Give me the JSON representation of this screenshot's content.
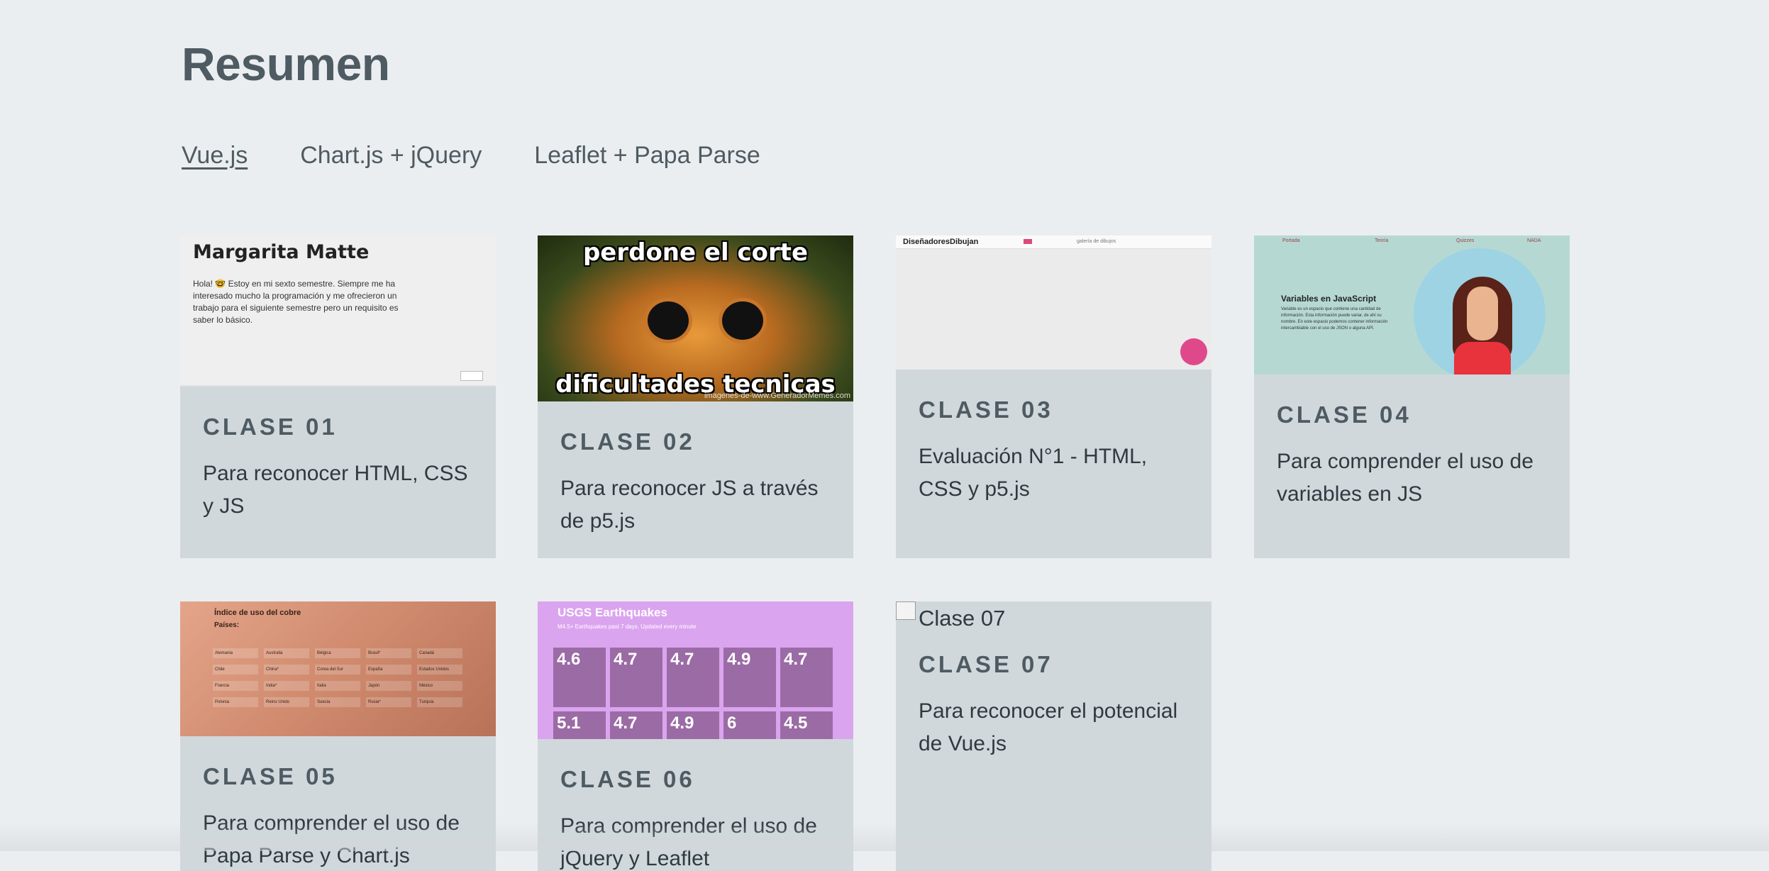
{
  "header": {
    "title": "Resumen"
  },
  "tabs": [
    {
      "label": "Vue.js",
      "active": true
    },
    {
      "label": "Chart.js + jQuery",
      "active": false
    },
    {
      "label": "Leaflet + Papa Parse",
      "active": false
    }
  ],
  "cards": [
    {
      "class_label": "CLASE 01",
      "description": "Para reconocer HTML, CSS y JS",
      "thumb": {
        "name": "Margarita Matte",
        "text": "Hola! 🤓 Estoy en mi sexto semestre. Siempre me ha interesado mucho la programación y me ofrecieron un trabajo para el siguiente semestre pero un requisito es saber lo básico."
      }
    },
    {
      "class_label": "CLASE 02",
      "description": "Para reconocer JS a través de p5.js",
      "thumb": {
        "top": "perdone el corte",
        "bottom": "dificultades tecnicas",
        "watermark": "imagenes-de-www.GeneradorMemes.com"
      }
    },
    {
      "class_label": "CLASE 03",
      "description": "Evaluación N°1 - HTML, CSS y p5.js",
      "thumb": {
        "brand": "DiseñadoresDibujan",
        "gallery": "galería de dibujos"
      }
    },
    {
      "class_label": "CLASE 04",
      "description": "Para comprender el uso de variables en JS",
      "thumb": {
        "title": "Variables en JavaScript",
        "nav": [
          "Portada",
          "Teoría",
          "Quizzes",
          "NADA"
        ],
        "text": "Variable es un espacio que contiene una cantidad de información. Esta información puede variar, de ahí su nombre. En este espacio podemos contener información intercambiable con el uso de JSON o alguna API."
      }
    },
    {
      "class_label": "CLASE 05",
      "description": "Para comprender el uso de Papa Parse y Chart.js",
      "thumb": {
        "title": "Índice de uso del cobre",
        "subtitle": "Países:",
        "countries": [
          "Alemania",
          "Australia",
          "Bélgica",
          "Brasil*",
          "Canadá",
          "Chile",
          "China*",
          "Corea del Sur",
          "España",
          "Estados Unidos",
          "Francia",
          "India*",
          "Italia",
          "Japón",
          "México",
          "Polonia",
          "Reino Unido",
          "Suecia",
          "Rusia*",
          "Turquía"
        ]
      }
    },
    {
      "class_label": "CLASE 06",
      "description": "Para comprender el uso de jQuery y Leaflet",
      "thumb": {
        "title": "USGS Earthquakes",
        "subtitle": "M4.5+ Earthquakes past 7 days. Updated every minute",
        "magnitudes": [
          "4.6",
          "4.7",
          "4.7",
          "4.9",
          "4.7",
          "5.1",
          "4.7",
          "4.9",
          "6",
          "4.5"
        ]
      }
    },
    {
      "class_label": "CLASE 07",
      "description": "Para reconocer el potencial de Vue.js",
      "thumb": {
        "alt": "Clase 07"
      }
    }
  ]
}
